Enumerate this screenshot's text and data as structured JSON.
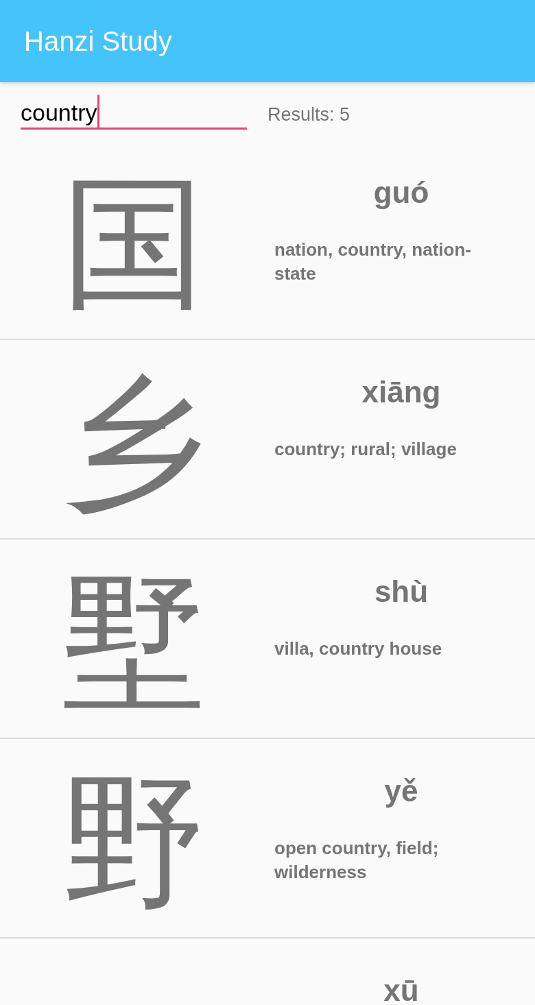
{
  "app_bar": {
    "title": "Hanzi Study"
  },
  "search": {
    "value": "country"
  },
  "results_label": "Results: 5",
  "entries": [
    {
      "hanzi": "国",
      "pinyin": "guó",
      "meaning": "nation, country, nation-state"
    },
    {
      "hanzi": "乡",
      "pinyin": "xiāng",
      "meaning": "country; rural; village"
    },
    {
      "hanzi": "墅",
      "pinyin": "shù",
      "meaning": "villa, country house"
    },
    {
      "hanzi": "野",
      "pinyin": "yě",
      "meaning": "open country, field; wilderness"
    },
    {
      "pinyin": "xū"
    }
  ]
}
